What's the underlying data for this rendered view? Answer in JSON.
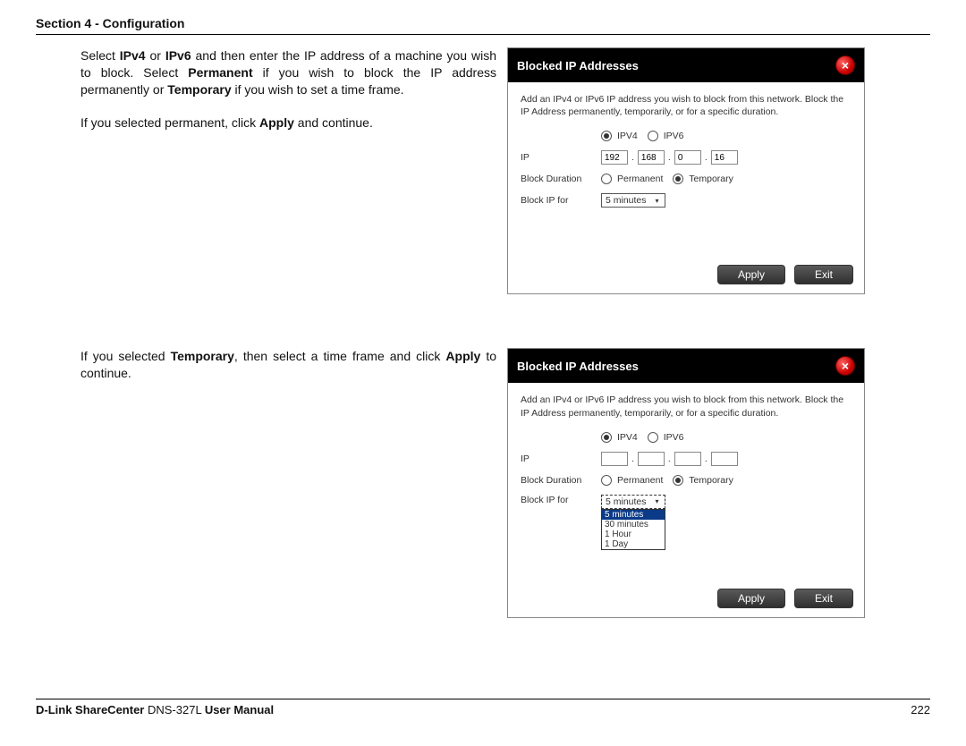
{
  "header": "Section 4 - Configuration",
  "block1": {
    "text1_plain": "Select IPv4 or IPv6 and then enter the IP address of a machine you wish to block. Select Permanent if you wish to block the IP address permanently or Temporary if you wish to set a time frame.",
    "text2_plain": "If you selected permanent, click Apply and continue.",
    "panel_title": "Blocked IP Addresses",
    "panel_desc": "Add an IPv4 or IPv6 IP address you wish to block from this network. Block the IP Address permanently, temporarily, or for a specific duration.",
    "ipv4": "IPV4",
    "ipv6": "IPV6",
    "label_ip": "IP",
    "ip_oct": [
      "192",
      "168",
      "0",
      "16"
    ],
    "label_dur": "Block Duration",
    "opt_perm": "Permanent",
    "opt_temp": "Temporary",
    "label_for": "Block IP for",
    "select_val": "5 minutes",
    "btn_apply": "Apply",
    "btn_exit": "Exit"
  },
  "block2": {
    "text1_plain": "If you selected Temporary, then select a time frame and click Apply to continue.",
    "panel_title": "Blocked IP Addresses",
    "panel_desc": "Add an IPv4 or IPv6 IP address you wish to block from this network. Block the IP Address permanently, temporarily, or for a specific duration.",
    "ipv4": "IPV4",
    "ipv6": "IPV6",
    "label_ip": "IP",
    "ip_oct": [
      "",
      "",
      "",
      ""
    ],
    "label_dur": "Block Duration",
    "opt_perm": "Permanent",
    "opt_temp": "Temporary",
    "label_for": "Block IP for",
    "select_val": "5 minutes",
    "dropdown": [
      "5 minutes",
      "30 minutes",
      "1 Hour",
      "1 Day"
    ],
    "btn_apply": "Apply",
    "btn_exit": "Exit"
  },
  "footer": {
    "brand": "D-Link ShareCenter",
    "product": " DNS-327L ",
    "tail": "User Manual",
    "page": "222"
  }
}
